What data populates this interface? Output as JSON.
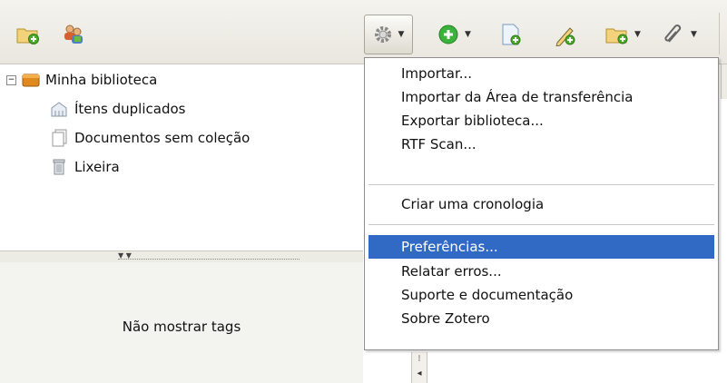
{
  "toolbar": {
    "buttons": [
      {
        "name": "new-collection",
        "icon": "folder-add-icon"
      },
      {
        "name": "new-group",
        "icon": "group-icon"
      },
      {
        "name": "actions",
        "icon": "gear-icon",
        "dropdown": true
      },
      {
        "name": "new-item",
        "icon": "plus-circle-icon",
        "dropdown": true
      },
      {
        "name": "add-by-identifier",
        "icon": "page-add-icon"
      },
      {
        "name": "new-note",
        "icon": "note-pencil-icon"
      },
      {
        "name": "attach",
        "icon": "folder-attach-icon",
        "dropdown": true
      },
      {
        "name": "link",
        "icon": "paperclip-icon",
        "dropdown": true
      }
    ]
  },
  "tree": {
    "library": "Minha biblioteca",
    "items": [
      {
        "label": "Ítens duplicados",
        "icon": "duplicate-icon"
      },
      {
        "label": "Documentos sem coleção",
        "icon": "documents-icon"
      },
      {
        "label": "Lixeira",
        "icon": "trash-icon"
      }
    ]
  },
  "tag_pane": {
    "text": "Não mostrar tags"
  },
  "menu": {
    "groups": [
      [
        "Importar...",
        "Importar da Área de transferência",
        "Exportar biblioteca...",
        "RTF Scan..."
      ],
      [
        "Criar uma cronologia"
      ],
      [
        "Preferências...",
        "Relatar erros...",
        "Suporte e documentação",
        "Sobre Zotero"
      ]
    ],
    "selected": "Preferências..."
  },
  "colors": {
    "selection": "#316ac5",
    "toolbar": "#e9e7df"
  }
}
